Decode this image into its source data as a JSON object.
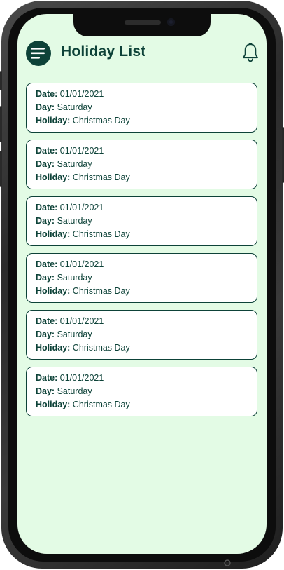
{
  "header": {
    "title": "Holiday List",
    "menu_icon": "menu-icon",
    "notification_icon": "bell-icon"
  },
  "colors": {
    "accent": "#0d4238",
    "screen_background": "#e3fbe5",
    "card_background": "#ffffff"
  },
  "labels": {
    "date": "Date:",
    "day": "Day:",
    "holiday": "Holiday:"
  },
  "holidays": [
    {
      "date": "01/01/2021",
      "day": "Saturday",
      "holiday": "Christmas Day"
    },
    {
      "date": "01/01/2021",
      "day": "Saturday",
      "holiday": "Christmas Day"
    },
    {
      "date": "01/01/2021",
      "day": "Saturday",
      "holiday": "Christmas Day"
    },
    {
      "date": "01/01/2021",
      "day": "Saturday",
      "holiday": "Christmas Day"
    },
    {
      "date": "01/01/2021",
      "day": "Saturday",
      "holiday": "Christmas Day"
    },
    {
      "date": "01/01/2021",
      "day": "Saturday",
      "holiday": "Christmas Day"
    }
  ]
}
